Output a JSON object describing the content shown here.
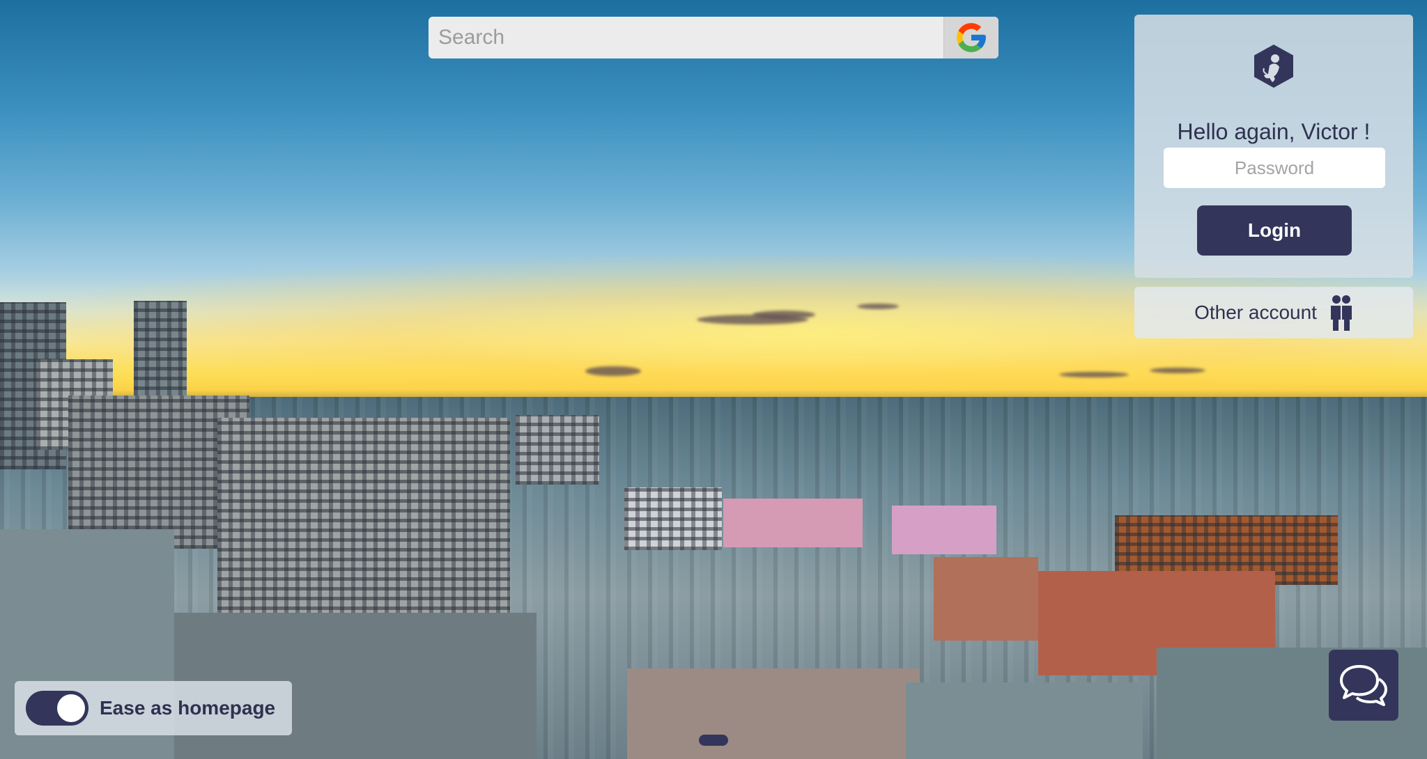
{
  "search": {
    "placeholder": "Search",
    "engine_icon": "google-g-icon"
  },
  "login": {
    "avatar_icon": "monkey-hexagon-icon",
    "greeting": "Hello again, Victor !",
    "password_placeholder": "Password",
    "button_label": "Login"
  },
  "other_account": {
    "label": "Other account",
    "icon": "two-people-icon"
  },
  "homepage_toggle": {
    "label": "Ease as homepage",
    "enabled": true
  },
  "chat": {
    "icon": "chat-bubbles-icon"
  },
  "colors": {
    "accent": "#33365a",
    "panel": "#d6dee4"
  }
}
